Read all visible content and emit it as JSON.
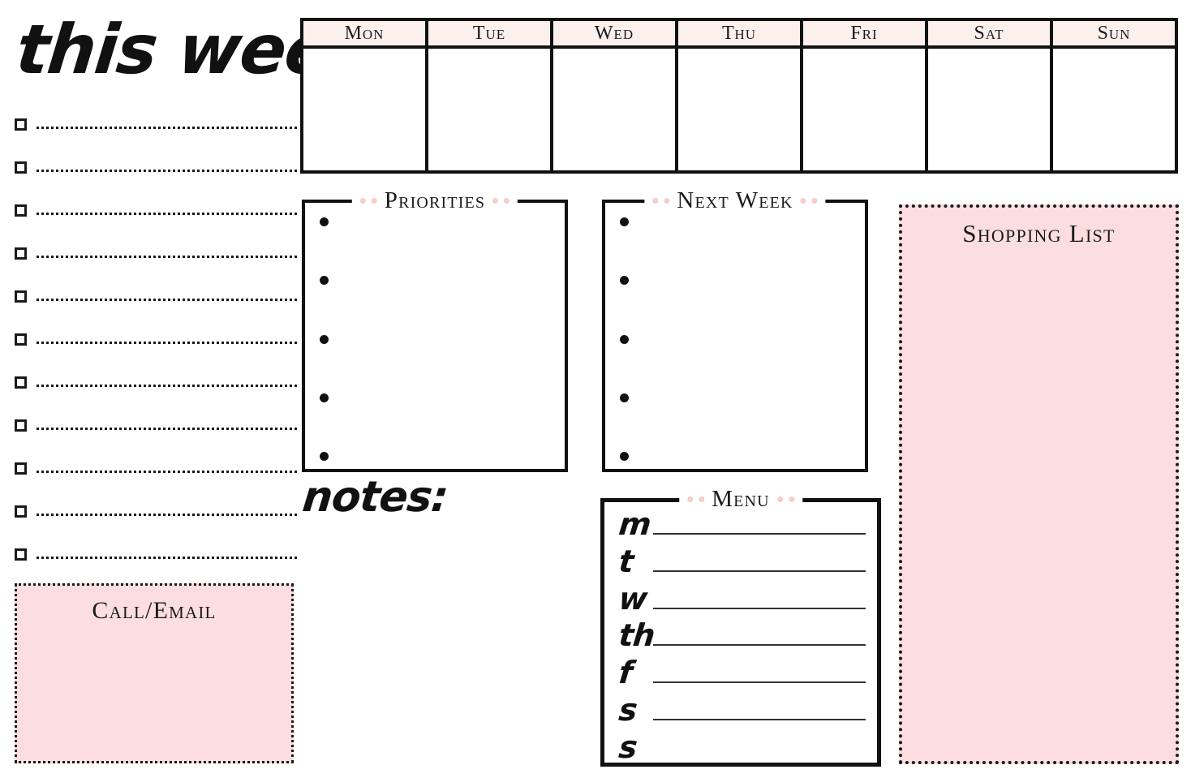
{
  "page": {
    "title": "this week",
    "colors": {
      "panel_pink": "#fcdee0",
      "header_pink": "#fcf0ec",
      "accent_dot_pink": "#f6cdc8",
      "ink": "#111111",
      "paper": "#ffffff"
    }
  },
  "checklist": {
    "name": "this-week-checklist",
    "rows": [
      {
        "checked": false,
        "text": ""
      },
      {
        "checked": false,
        "text": ""
      },
      {
        "checked": false,
        "text": ""
      },
      {
        "checked": false,
        "text": ""
      },
      {
        "checked": false,
        "text": ""
      },
      {
        "checked": false,
        "text": ""
      },
      {
        "checked": false,
        "text": ""
      },
      {
        "checked": false,
        "text": ""
      },
      {
        "checked": false,
        "text": ""
      },
      {
        "checked": false,
        "text": ""
      },
      {
        "checked": false,
        "text": ""
      }
    ]
  },
  "call_email": {
    "title": "Call/Email",
    "content": ""
  },
  "week_grid": {
    "days": [
      {
        "label": "Mon",
        "content": ""
      },
      {
        "label": "Tue",
        "content": ""
      },
      {
        "label": "Wed",
        "content": ""
      },
      {
        "label": "Thu",
        "content": ""
      },
      {
        "label": "Fri",
        "content": ""
      },
      {
        "label": "Sat",
        "content": ""
      },
      {
        "label": "Sun",
        "content": ""
      }
    ]
  },
  "priorities": {
    "title": "Priorities",
    "items": [
      "",
      "",
      "",
      "",
      ""
    ]
  },
  "next_week": {
    "title": "Next Week",
    "items": [
      "",
      "",
      "",
      "",
      ""
    ]
  },
  "notes": {
    "label": "notes:",
    "content": ""
  },
  "menu": {
    "title": "Menu",
    "rows": [
      {
        "day": "m",
        "meal": ""
      },
      {
        "day": "t",
        "meal": ""
      },
      {
        "day": "w",
        "meal": ""
      },
      {
        "day": "th",
        "meal": ""
      },
      {
        "day": "f",
        "meal": ""
      },
      {
        "day": "s",
        "meal": ""
      },
      {
        "day": "s",
        "meal": ""
      }
    ]
  },
  "shopping_list": {
    "title": "Shopping List",
    "items": []
  }
}
